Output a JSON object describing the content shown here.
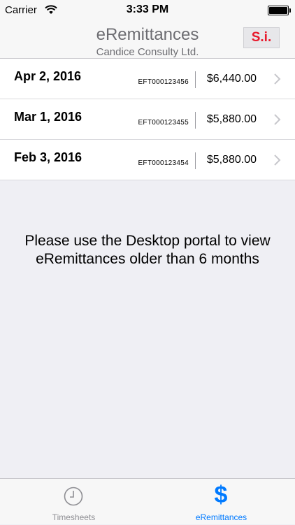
{
  "status_bar": {
    "carrier": "Carrier",
    "time": "3:33 PM"
  },
  "nav": {
    "title": "eRemittances",
    "subtitle": "Candice Consulty Ltd.",
    "logo_text": "S.i."
  },
  "remittances": [
    {
      "date": "Apr 2, 2016",
      "ref": "EFT000123456",
      "amount": "$6,440.00"
    },
    {
      "date": "Mar 1, 2016",
      "ref": "EFT000123455",
      "amount": "$5,880.00"
    },
    {
      "date": "Feb 3, 2016",
      "ref": "EFT000123454",
      "amount": "$5,880.00"
    }
  ],
  "notice": {
    "line1": "Please use the Desktop portal to view",
    "line2": "eRemittances older than 6 months"
  },
  "tabs": [
    {
      "label": "Timesheets",
      "icon": "clock-icon",
      "active": false
    },
    {
      "label": "eRemittances",
      "icon": "dollar-icon",
      "active": true
    }
  ],
  "colors": {
    "accent": "#007aff",
    "logo_red": "#e8192c",
    "inactive": "#8e8e93",
    "background": "#efeff4"
  }
}
